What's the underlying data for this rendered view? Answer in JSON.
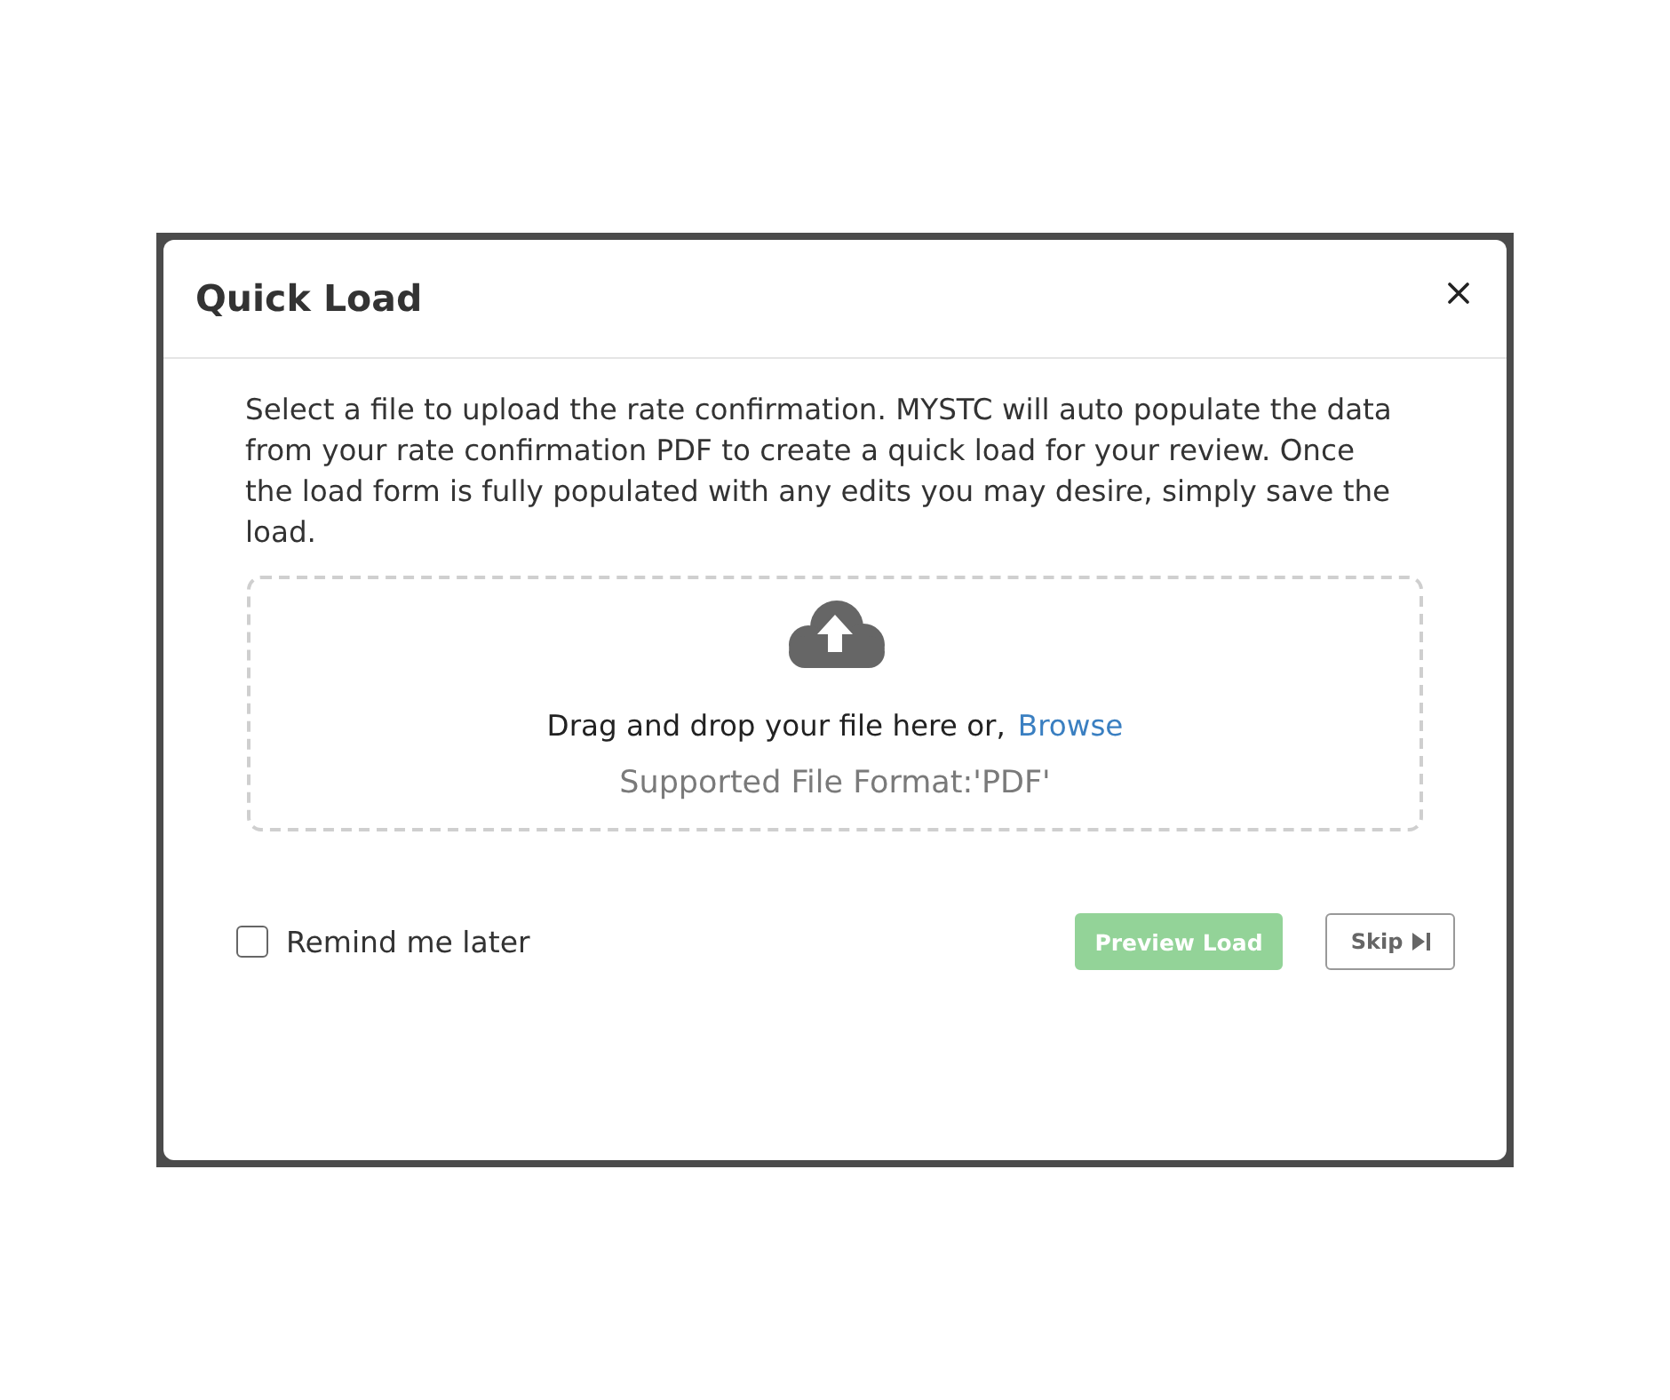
{
  "dialog": {
    "title": "Quick Load"
  },
  "description": "Select a file to upload the rate confirmation. MYSTC will auto populate the data from your rate confirmation PDF to create a quick load for your review. Once the load form is fully populated with any edits you may desire, simply save the load.",
  "dropzone": {
    "prompt": "Drag and drop your file here or,",
    "link": "Browse",
    "formats": "Supported File Format:'PDF'"
  },
  "reminder": {
    "label": "Remind me later",
    "checked": false
  },
  "buttons": [
    {
      "kind": "primary",
      "label": "Preview Load",
      "disabled": true
    },
    {
      "kind": "skip",
      "label": "Skip",
      "disabled": false
    }
  ]
}
